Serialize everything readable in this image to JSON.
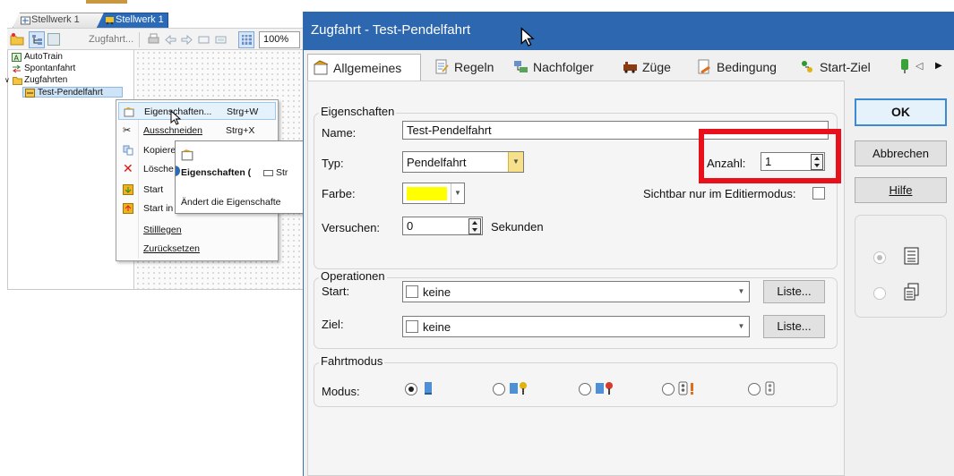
{
  "left_window": {
    "tabs": [
      {
        "label": "Stellwerk 1"
      },
      {
        "label": "Stellwerk 1"
      }
    ],
    "toolbar": {
      "zugfahrt_label": "Zugfahrt...",
      "zoom": "100%"
    },
    "tree": [
      {
        "label": "AutoTrain"
      },
      {
        "label": "Spontanfahrt"
      },
      {
        "label": "Zugfahrten"
      },
      {
        "label": "Test-Pendelfahrt"
      }
    ],
    "context_menu": {
      "items": [
        {
          "label": "Eigenschaften...",
          "shortcut": "Strg+W"
        },
        {
          "label": "Ausschneiden",
          "shortcut": "Strg+X"
        },
        {
          "label": "Kopiere",
          "shortcut": ""
        },
        {
          "label": "Lösche",
          "shortcut": ""
        },
        {
          "label": "Start",
          "shortcut": ""
        },
        {
          "label": "Start in",
          "shortcut": ""
        },
        {
          "label": "Stilllegen",
          "shortcut": ""
        },
        {
          "label": "Zurücksetzen",
          "shortcut": ""
        }
      ]
    },
    "tooltip": {
      "title": "Eigenschaften (",
      "title_after": "Str",
      "description": "Ändert die Eigenschafte"
    }
  },
  "dialog": {
    "title": "Zugfahrt - Test-Pendelfahrt",
    "tabs": [
      {
        "label": "Allgemeines",
        "active": true
      },
      {
        "label": "Regeln"
      },
      {
        "label": "Nachfolger"
      },
      {
        "label": "Züge"
      },
      {
        "label": "Bedingung"
      },
      {
        "label": "Start-Ziel"
      }
    ],
    "tab_scroll_left": "◁",
    "tab_scroll_right": "▶",
    "eigenschaften": {
      "group_title": "Eigenschaften",
      "name_label": "Name:",
      "name_value": "Test-Pendelfahrt",
      "typ_label": "Typ:",
      "typ_value": "Pendelfahrt",
      "anzahl_label": "Anzahl:",
      "anzahl_value": "1",
      "farbe_label": "Farbe:",
      "farbe_color": "#ffff00",
      "sichtbar_label": "Sichtbar nur im Editiermodus:",
      "versuchen_label": "Versuchen:",
      "versuchen_value": "0",
      "sekunden_label": "Sekunden"
    },
    "operationen": {
      "group_title": "Operationen",
      "start_label": "Start:",
      "start_value": "keine",
      "ziel_label": "Ziel:",
      "ziel_value": "keine",
      "liste_label": "Liste..."
    },
    "fahrtmodus": {
      "group_title": "Fahrtmodus",
      "modus_label": "Modus:",
      "selected_index": 0,
      "options": 5
    },
    "buttons": {
      "ok": "OK",
      "abbrechen": "Abbrechen",
      "hilfe": "Hilfe"
    },
    "highlight_color": "#e8111b",
    "accent_color": "#2c67b0"
  }
}
